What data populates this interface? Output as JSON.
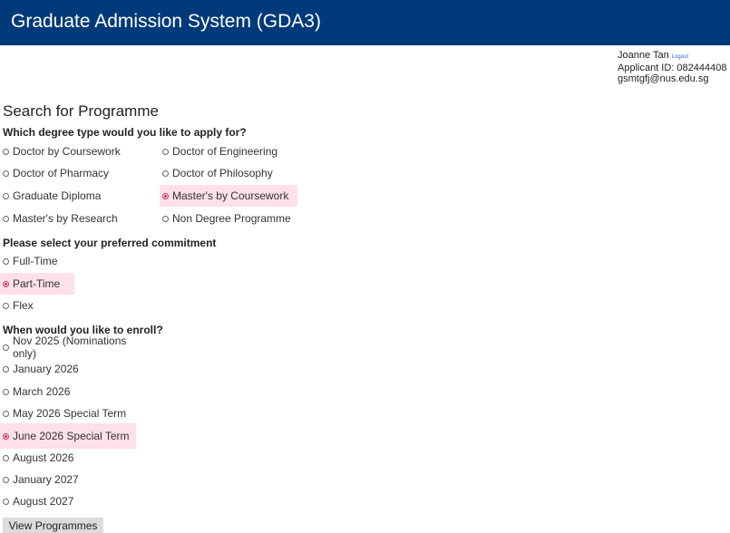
{
  "header": {
    "title": "Graduate Admission System (GDA3)",
    "background": "#003a7a"
  },
  "user": {
    "name": "Joanne Tan",
    "logout_label": "Logout",
    "applicant_id": "Applicant ID: 082444408",
    "email": "gsmtgfj@nus.edu.sg"
  },
  "page_title": "Search for Programme",
  "highlight_color": "#fde0e9",
  "degree": {
    "question": "Which degree type would you like to apply for?",
    "options": [
      {
        "label": "Doctor by Coursework",
        "selected": false
      },
      {
        "label": "Doctor of Engineering",
        "selected": false
      },
      {
        "label": "Doctor of Pharmacy",
        "selected": false
      },
      {
        "label": "Doctor of Philosophy",
        "selected": false
      },
      {
        "label": "Graduate Diploma",
        "selected": false
      },
      {
        "label": "Master's by Coursework",
        "selected": true
      },
      {
        "label": "Master's by Research",
        "selected": false
      },
      {
        "label": "Non Degree Programme",
        "selected": false
      }
    ]
  },
  "commitment": {
    "question": "Please select your preferred commitment",
    "options": [
      {
        "label": "Full-Time",
        "selected": false
      },
      {
        "label": "Part-Time",
        "selected": true
      },
      {
        "label": "Flex",
        "selected": false
      }
    ]
  },
  "enroll": {
    "question": "When would you like to enroll?",
    "options": [
      {
        "label": "Nov 2025 (Nominations only)",
        "selected": false
      },
      {
        "label": "January 2026",
        "selected": false
      },
      {
        "label": "March 2026",
        "selected": false
      },
      {
        "label": "May 2026 Special Term",
        "selected": false
      },
      {
        "label": "June 2026 Special Term",
        "selected": true
      },
      {
        "label": "August 2026",
        "selected": false
      },
      {
        "label": "January 2027",
        "selected": false
      },
      {
        "label": "August 2027",
        "selected": false
      }
    ]
  },
  "view_button_label": "View Programmes"
}
